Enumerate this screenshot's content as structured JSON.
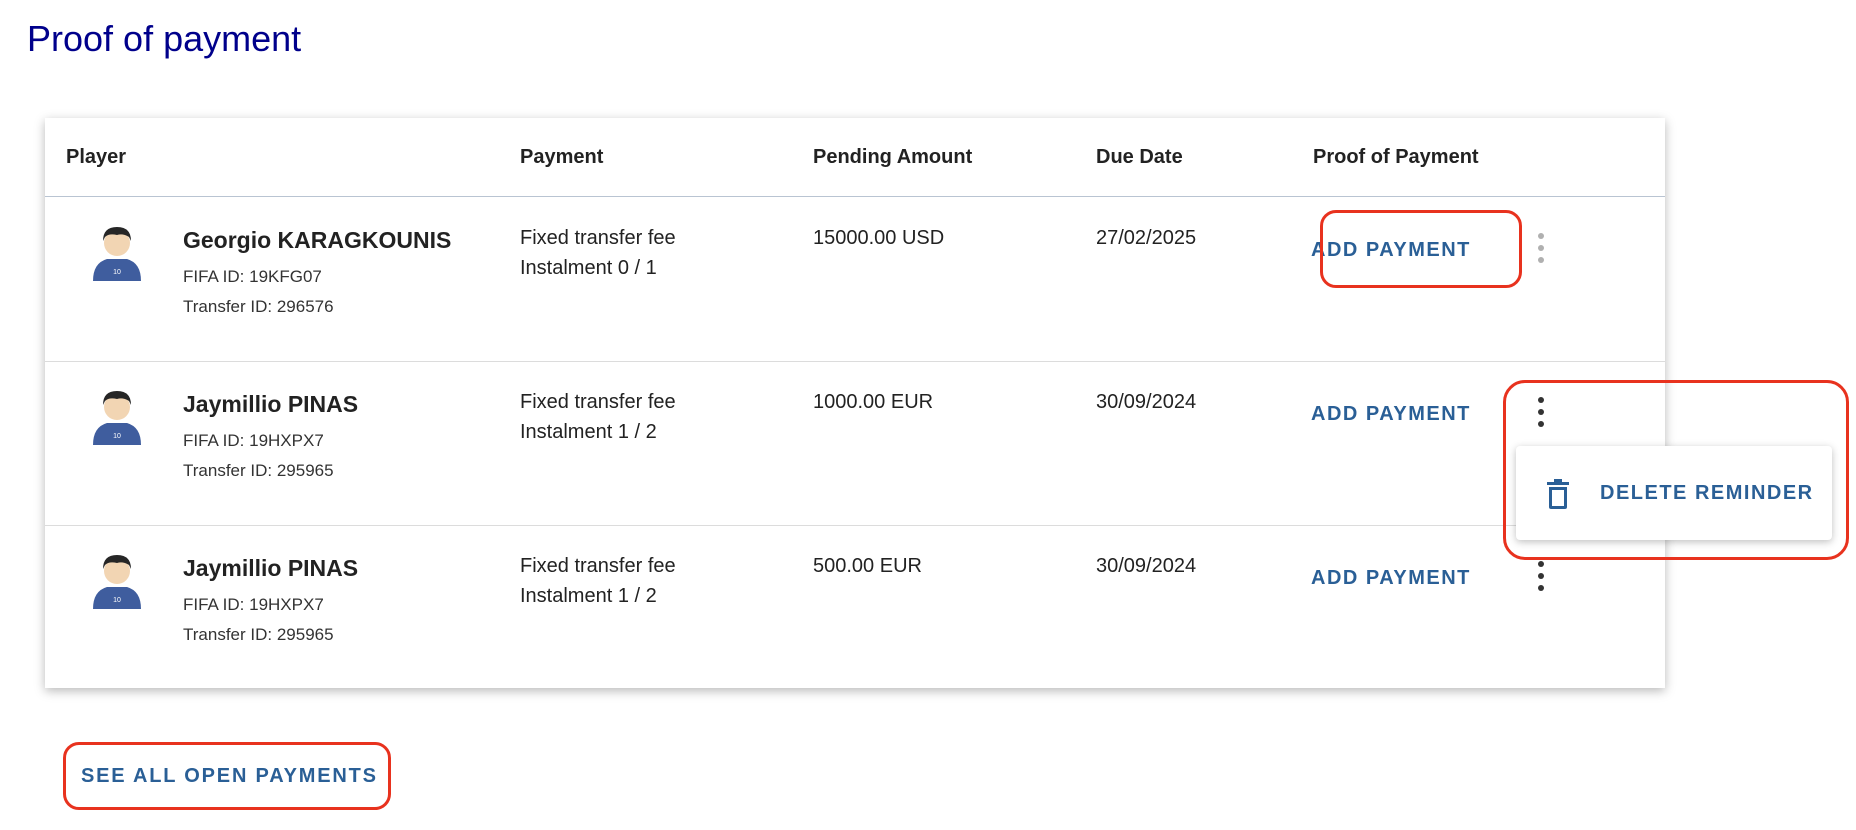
{
  "page": {
    "title": "Proof of payment"
  },
  "table": {
    "headers": {
      "player": "Player",
      "payment": "Payment",
      "pending_amount": "Pending Amount",
      "due_date": "Due Date",
      "proof_of_payment": "Proof of Payment"
    },
    "rows": [
      {
        "name": "Georgio KARAGKOUNIS",
        "fifa_id": "FIFA ID: 19KFG07",
        "transfer_id": "Transfer ID: 296576",
        "payment_type": "Fixed transfer fee",
        "instalment": "Instalment 0 / 1",
        "amount": "15000.00 USD",
        "due_date": "27/02/2025",
        "action_label": "ADD PAYMENT"
      },
      {
        "name": "Jaymillio PINAS",
        "fifa_id": "FIFA ID: 19HXPX7",
        "transfer_id": "Transfer ID: 295965",
        "payment_type": "Fixed transfer fee",
        "instalment": "Instalment 1 / 2",
        "amount": "1000.00 EUR",
        "due_date": "30/09/2024",
        "action_label": "ADD PAYMENT"
      },
      {
        "name": "Jaymillio PINAS",
        "fifa_id": "FIFA ID: 19HXPX7",
        "transfer_id": "Transfer ID: 295965",
        "payment_type": "Fixed transfer fee",
        "instalment": "Instalment 1 / 2",
        "amount": "500.00 EUR",
        "due_date": "30/09/2024",
        "action_label": "ADD PAYMENT"
      }
    ]
  },
  "context_menu": {
    "delete_label": "DELETE REMINDER",
    "icon": "trash-icon"
  },
  "footer": {
    "see_all_label": "SEE ALL OPEN PAYMENTS"
  },
  "colors": {
    "title": "#00008b",
    "action": "#2a5f96",
    "highlight": "#e8321e",
    "avatar_shirt": "#3f5d9e"
  },
  "icons": {
    "avatar": "player-avatar-icon",
    "more": "more-vert-icon"
  }
}
